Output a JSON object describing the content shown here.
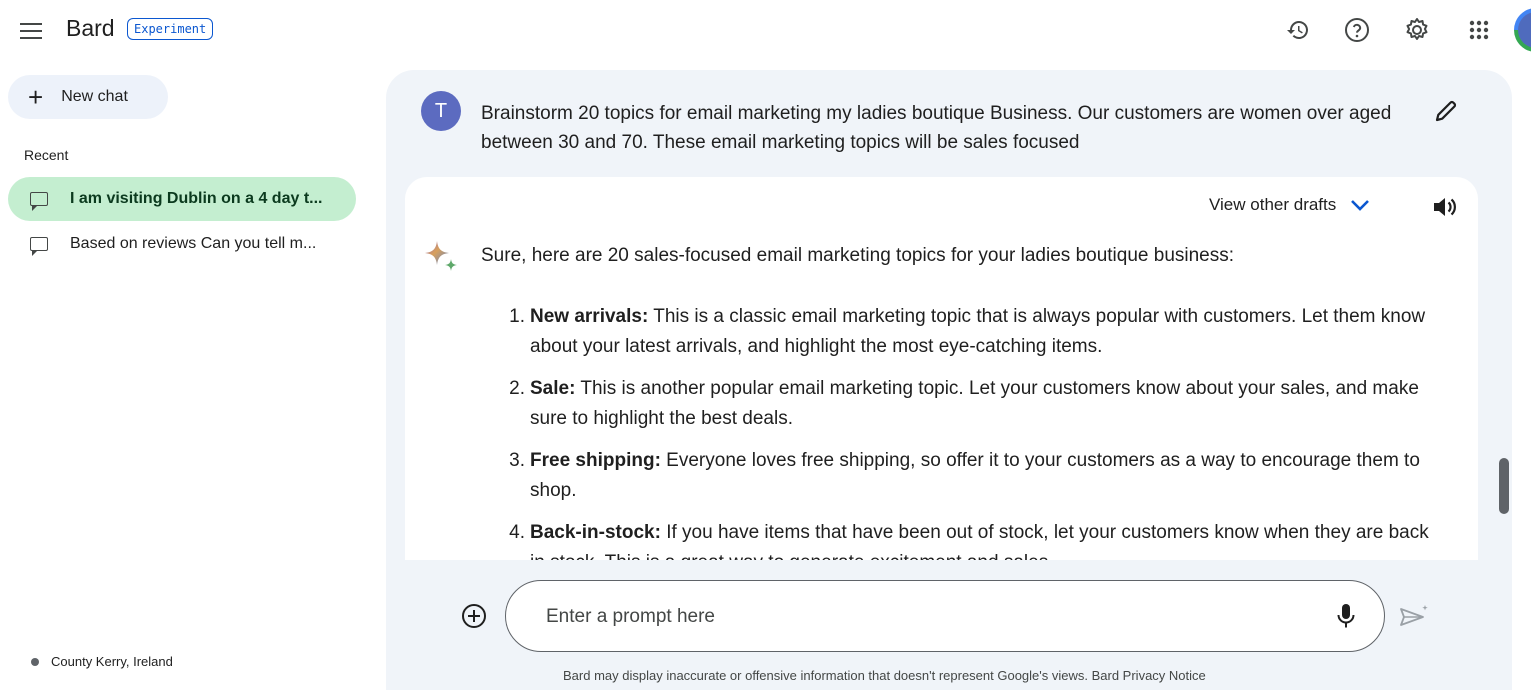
{
  "header": {
    "app_name": "Bard",
    "badge": "Experiment",
    "icons": [
      "history-icon",
      "help-icon",
      "settings-icon",
      "apps-grid-icon"
    ]
  },
  "sidebar": {
    "new_chat_label": "New chat",
    "recent_label": "Recent",
    "items": [
      {
        "label": "I am visiting Dublin on a 4 day t...",
        "active": true
      },
      {
        "label": "Based on reviews Can you tell m...",
        "active": false
      }
    ],
    "location": "County Kerry, Ireland"
  },
  "conversation": {
    "user_initial": "T",
    "prompt": "Brainstorm  20 topics for email marketing my ladies boutique Business.  Our customers are   women over aged between 30 and 70. These email marketing topics will be sales focused",
    "view_drafts_label": "View other drafts",
    "response_intro": "Sure, here are 20 sales-focused email marketing topics for your ladies boutique business:",
    "response_items": [
      {
        "num": "1.",
        "title": "New arrivals:",
        "text": " This is a classic email marketing topic that is always popular with customers. Let them know about your latest arrivals, and highlight the most eye-catching items."
      },
      {
        "num": "2.",
        "title": "Sale:",
        "text": " This is another popular email marketing topic. Let your customers know about your sales, and make sure to highlight the best deals."
      },
      {
        "num": "3.",
        "title": "Free shipping:",
        "text": " Everyone loves free shipping, so offer it to your customers as a way to encourage them to shop."
      },
      {
        "num": "4.",
        "title": "Back-in-stock:",
        "text": " If you have items that have been out of stock, let your customers know when they are back in stock. This is a great way to generate excitement and sales."
      }
    ]
  },
  "input": {
    "placeholder": "Enter a prompt here"
  },
  "footer": {
    "disclaimer": "Bard may display inaccurate or offensive information that doesn't represent Google's views. Bard Privacy Notice"
  },
  "colors": {
    "accent": "#0b57d0",
    "active_chat_bg": "#c4eed0",
    "panel_bg": "#f0f4f9"
  }
}
